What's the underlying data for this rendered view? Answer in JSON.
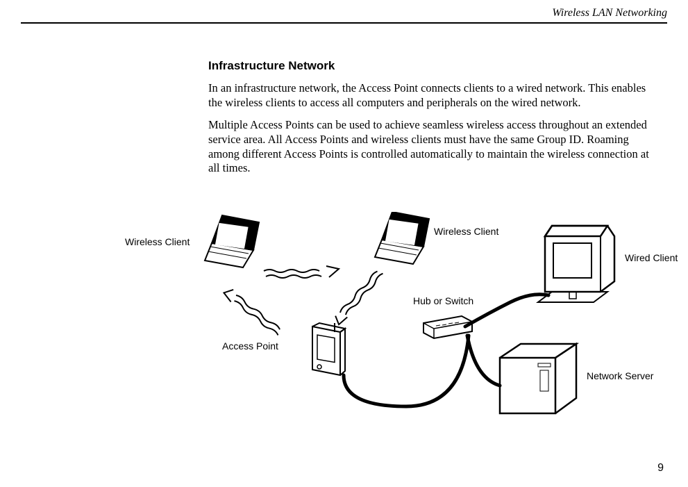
{
  "header": {
    "title": "Wireless LAN Networking"
  },
  "section": {
    "title": "Infrastructure Network",
    "p1": "In an infrastructure network, the Access Point connects clients to a wired network. This enables the wireless clients to access all computers and peripherals on the wired network.",
    "p2": "Multiple Access Points can be used to achieve seamless wireless access throughout an extended service area. All Access Points and wireless clients must have the same Group ID. Roaming among different Access Points is controlled automatically to maintain the wireless connection at all times."
  },
  "diagram": {
    "wireless_client_1": "Wireless Client",
    "wireless_client_2": "Wireless Client",
    "wired_client": "Wired Client",
    "hub": "Hub or Switch",
    "access_point": "Access Point",
    "network_server": "Network Server"
  },
  "page_number": "9"
}
